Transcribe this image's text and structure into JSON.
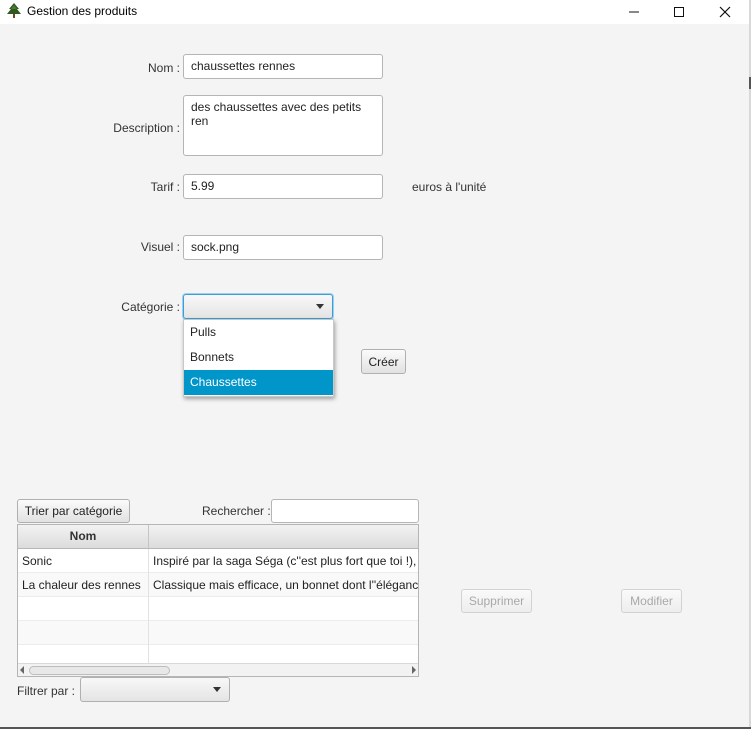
{
  "window": {
    "title": "Gestion des produits",
    "controls": {
      "minimize": "—",
      "maximize": "☐",
      "close": "✕"
    }
  },
  "form": {
    "nom": {
      "label": "Nom :",
      "value": "chaussettes rennes"
    },
    "description": {
      "label": "Description :",
      "value": "des chaussettes avec des petits ren"
    },
    "tarif": {
      "label": "Tarif :",
      "value": "5.99",
      "unit": "euros à l'unité"
    },
    "visuel": {
      "label": "Visuel :",
      "value": "sock.png"
    },
    "categorie": {
      "label": "Catégorie :",
      "value": "",
      "options": [
        "Pulls",
        "Bonnets",
        "Chaussettes"
      ],
      "highlighted": "Chaussettes"
    },
    "create_button": "Créer"
  },
  "list": {
    "sort_button": "Trier par catégorie",
    "search_label": "Rechercher :",
    "search_value": "",
    "columns": [
      "Nom",
      ""
    ],
    "rows": [
      [
        "Sonic",
        "Inspiré par la saga Séga (c''est plus fort que toi !), u"
      ],
      [
        "La chaleur des rennes",
        "Classique mais efficace, un bonnet dont l''élégance"
      ]
    ],
    "filter_label": "Filtrer par :",
    "filter_value": ""
  },
  "actions": {
    "delete_button": "Supprimer",
    "modify_button": "Modifier"
  },
  "colors": {
    "selection": "#0096c9",
    "focus": "#3b9fd6",
    "background": "#f4f4f4"
  }
}
